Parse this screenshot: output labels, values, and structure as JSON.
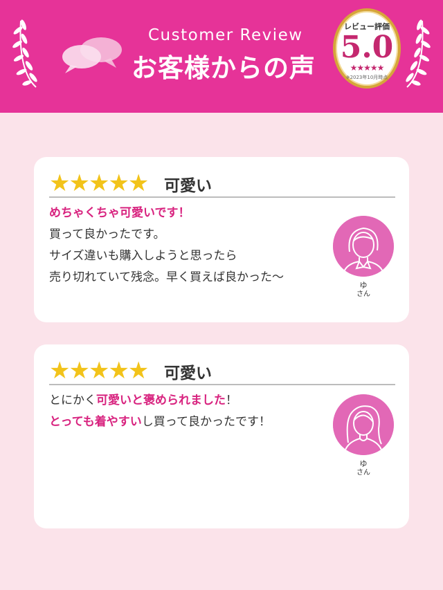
{
  "header": {
    "subtitle": "Customer Review",
    "title": "お客様からの声",
    "badge": {
      "label": "レビュー評価",
      "score": "5.0",
      "stars": "★★★★★",
      "note": "※2023年10月時点"
    }
  },
  "colors": {
    "brand": "#e63398",
    "accent": "#d8237f",
    "star": "#f2c31a",
    "avatar": "#e268b6"
  },
  "reviews": [
    {
      "stars": "★★★★★",
      "rating": 5,
      "title": "可愛い",
      "lines": [
        [
          {
            "text": "めちゃくちゃ可愛いです！",
            "hl": true
          }
        ],
        [
          {
            "text": "買って良かったです。",
            "hl": false
          }
        ],
        [
          {
            "text": "サイズ違いも購入しようと思ったら",
            "hl": false
          }
        ],
        [
          {
            "text": "売り切れていて残念。早く買えば良かった～",
            "hl": false
          }
        ]
      ],
      "name": "ゆ",
      "suffix": "さん",
      "avatar_icon": "woman-short-hair-icon"
    },
    {
      "stars": "★★★★★",
      "rating": 5,
      "title": "可愛い",
      "lines": [
        [
          {
            "text": "とにかく",
            "hl": false
          },
          {
            "text": "可愛いと褒められました",
            "hl": true
          },
          {
            "text": "！",
            "hl": false
          }
        ],
        [
          {
            "text": "とっても着やすい",
            "hl": true
          },
          {
            "text": "し買って良かったです！",
            "hl": false
          }
        ]
      ],
      "name": "ゆ",
      "suffix": "さん",
      "avatar_icon": "woman-long-hair-icon"
    }
  ]
}
